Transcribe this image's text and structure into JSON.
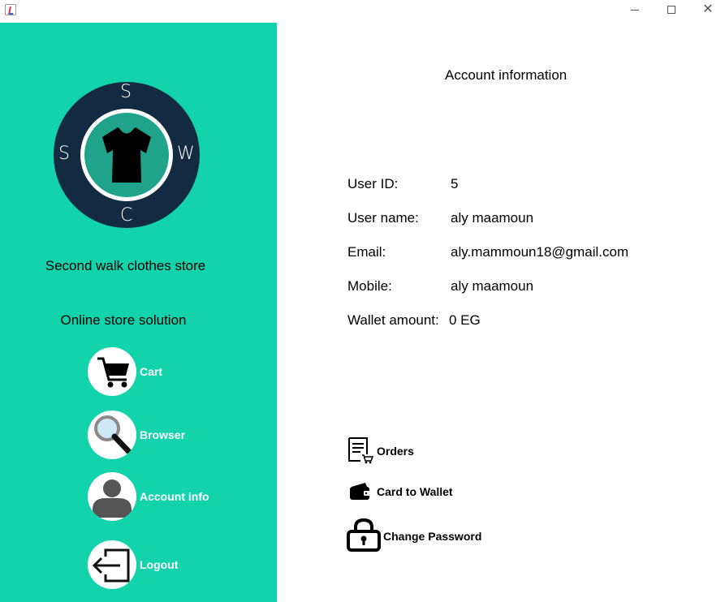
{
  "window": {
    "minimize_icon": "minimize-icon",
    "maximize_icon": "maximize-icon",
    "close_glyph": "✕"
  },
  "sidebar": {
    "logo": {
      "top": "S",
      "left": "S",
      "right": "W",
      "bottom": "C"
    },
    "store_name": "Second walk clothes store",
    "store_subtitle": "Online store solution",
    "nav": {
      "cart": "Cart",
      "browser": "Browser",
      "account": "Account info",
      "logout": "Logout"
    },
    "colors": {
      "background": "#13d3ad",
      "logo_dark": "#122a42",
      "logo_teal": "#1fa38b"
    }
  },
  "main": {
    "title": "Account information",
    "fields": {
      "user_id_label": "User ID:",
      "user_id_value": "5",
      "user_name_label": "User name:",
      "user_name_value": "aly maamoun",
      "email_label": "Email:",
      "email_value": "aly.mammoun18@gmail.com",
      "mobile_label": "Mobile:",
      "mobile_value": "aly maamoun",
      "wallet_label": "Wallet amount:",
      "wallet_value": "0 EG"
    },
    "actions": {
      "orders": "Orders",
      "card_to_wallet": "Card to Wallet",
      "change_password": "Change Password"
    }
  }
}
